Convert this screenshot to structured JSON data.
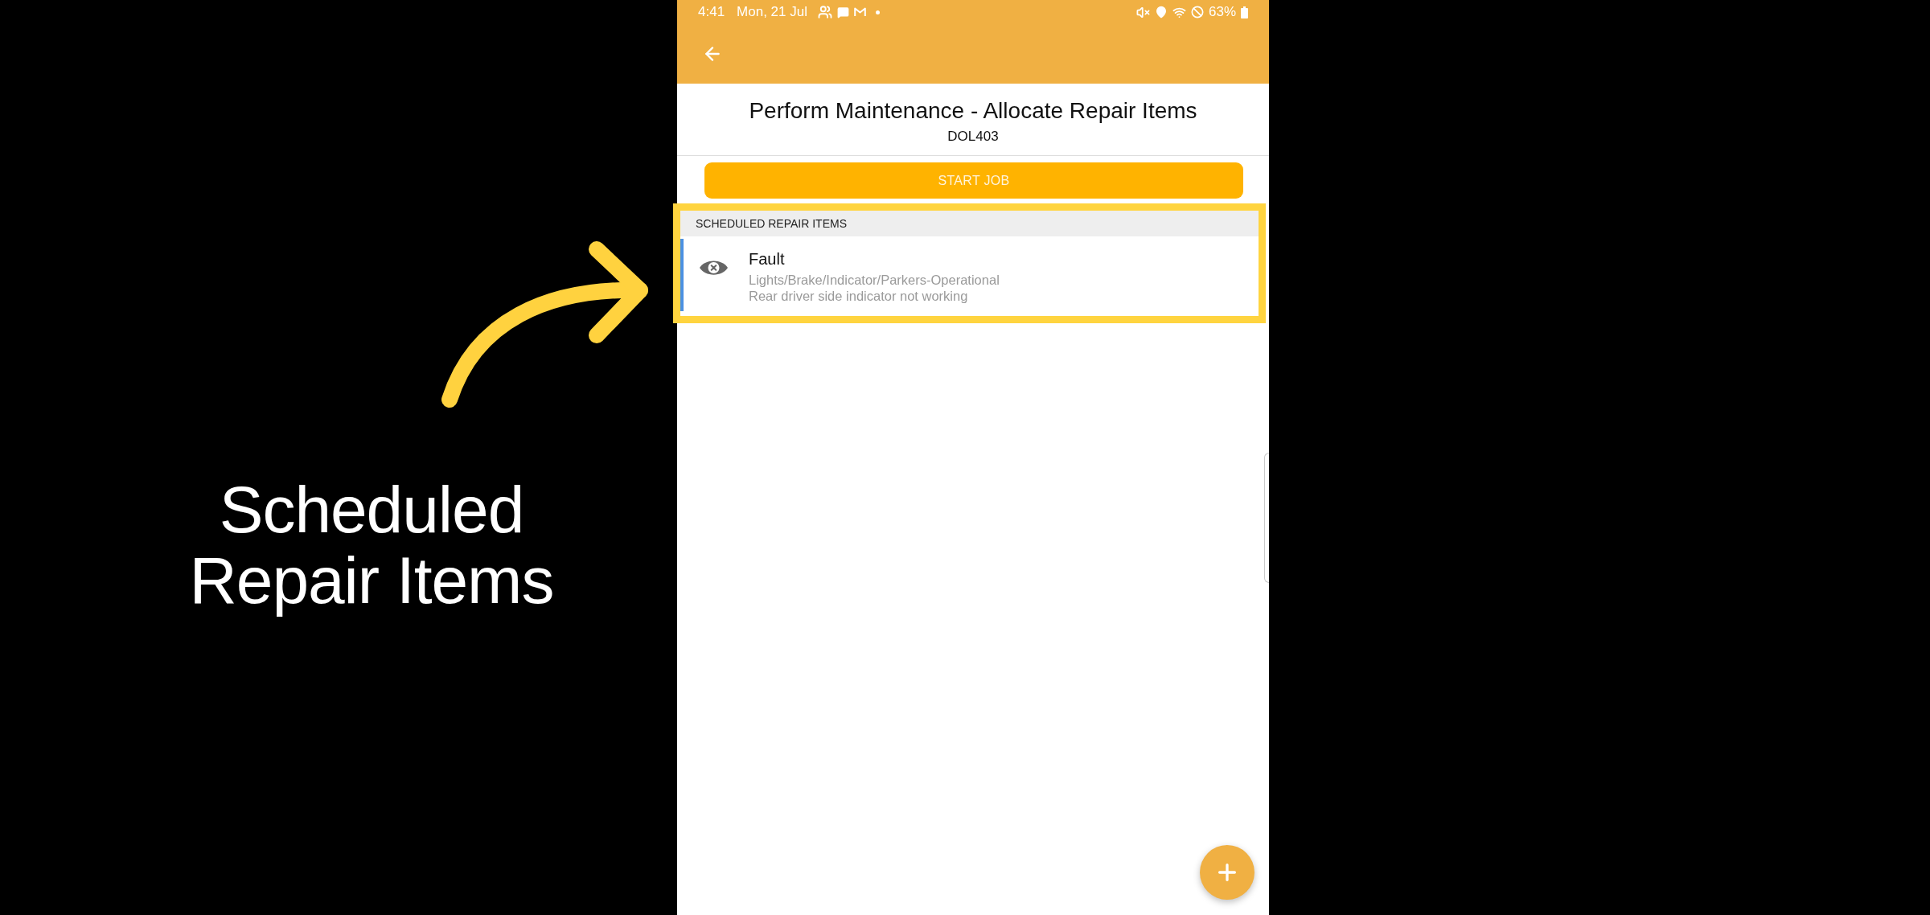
{
  "annotation": {
    "caption": "Scheduled Repair Items"
  },
  "status_bar": {
    "time": "4:41",
    "date": "Mon, 21 Jul",
    "battery": "63%"
  },
  "page": {
    "title": "Perform Maintenance - Allocate Repair Items",
    "subtitle": "DOL403"
  },
  "start_button": {
    "label": "START JOB"
  },
  "section": {
    "heading": "SCHEDULED REPAIR ITEMS",
    "highlighted": true,
    "items": [
      {
        "title": "Fault",
        "category": "Lights/Brake/Indicator/Parkers-Operational",
        "description": "Rear driver side indicator not working"
      }
    ]
  }
}
